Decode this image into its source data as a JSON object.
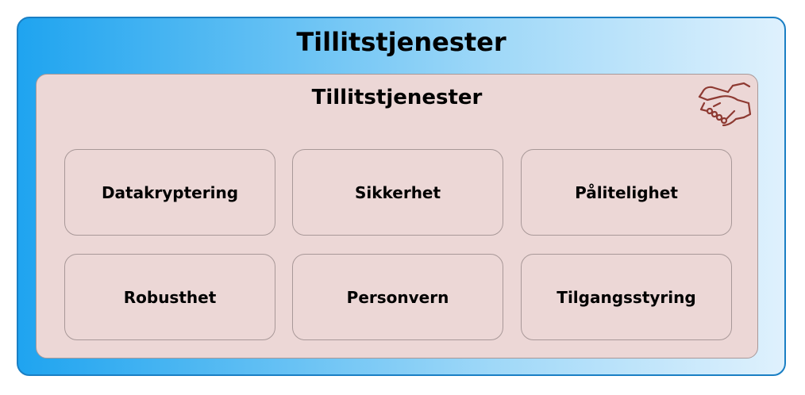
{
  "outer": {
    "title": "Tillitstjenester"
  },
  "inner": {
    "title": "Tillitstjenester",
    "icon": "handshake-icon",
    "items": [
      {
        "label": "Datakryptering"
      },
      {
        "label": "Sikkerhet"
      },
      {
        "label": "Pålitelighet"
      },
      {
        "label": "Robusthet"
      },
      {
        "label": "Personvern"
      },
      {
        "label": "Tilgangsstyring"
      }
    ]
  },
  "colors": {
    "outer_border": "#1a7fc4",
    "outer_gradient_start": "#1fa4f0",
    "outer_gradient_end": "#dff1fd",
    "inner_fill": "#ecd7d6",
    "inner_border": "#a89898",
    "icon_stroke": "#8e3a32"
  }
}
